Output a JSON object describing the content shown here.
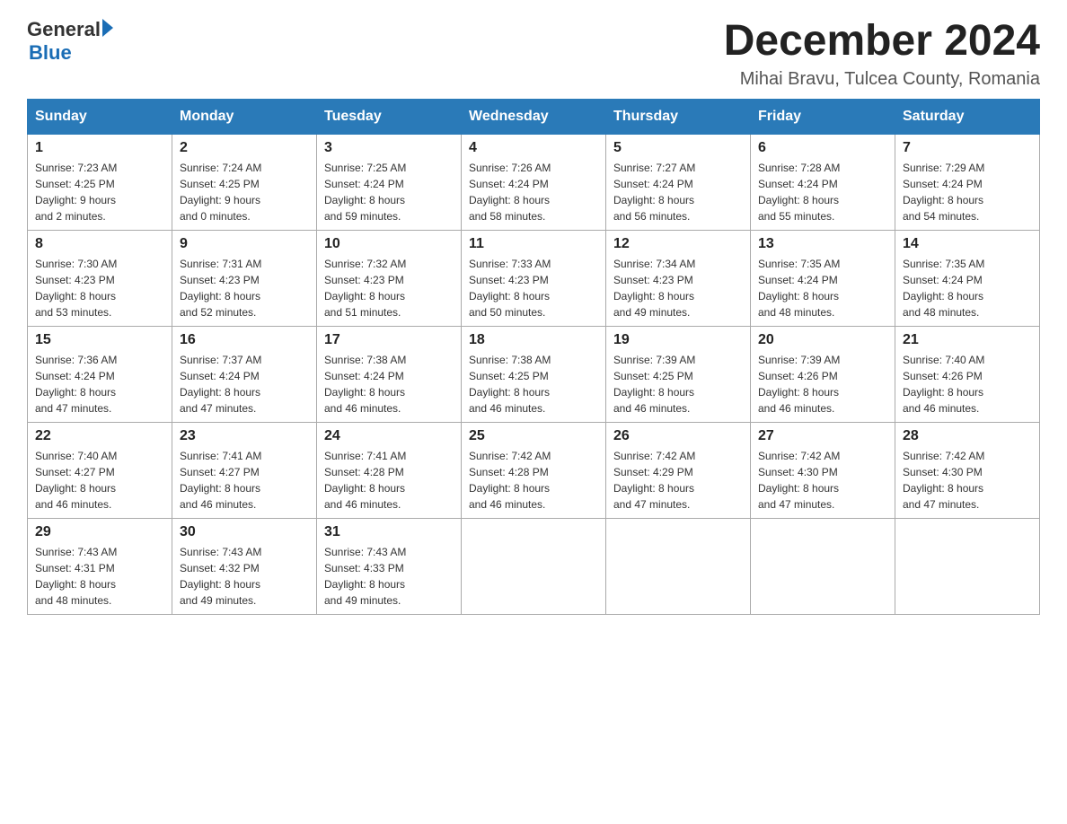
{
  "header": {
    "logo_general": "General",
    "logo_blue": "Blue",
    "month_title": "December 2024",
    "location": "Mihai Bravu, Tulcea County, Romania"
  },
  "days_of_week": [
    "Sunday",
    "Monday",
    "Tuesday",
    "Wednesday",
    "Thursday",
    "Friday",
    "Saturday"
  ],
  "weeks": [
    [
      {
        "day": "1",
        "sunrise": "7:23 AM",
        "sunset": "4:25 PM",
        "daylight": "9 hours and 2 minutes."
      },
      {
        "day": "2",
        "sunrise": "7:24 AM",
        "sunset": "4:25 PM",
        "daylight": "9 hours and 0 minutes."
      },
      {
        "day": "3",
        "sunrise": "7:25 AM",
        "sunset": "4:24 PM",
        "daylight": "8 hours and 59 minutes."
      },
      {
        "day": "4",
        "sunrise": "7:26 AM",
        "sunset": "4:24 PM",
        "daylight": "8 hours and 58 minutes."
      },
      {
        "day": "5",
        "sunrise": "7:27 AM",
        "sunset": "4:24 PM",
        "daylight": "8 hours and 56 minutes."
      },
      {
        "day": "6",
        "sunrise": "7:28 AM",
        "sunset": "4:24 PM",
        "daylight": "8 hours and 55 minutes."
      },
      {
        "day": "7",
        "sunrise": "7:29 AM",
        "sunset": "4:24 PM",
        "daylight": "8 hours and 54 minutes."
      }
    ],
    [
      {
        "day": "8",
        "sunrise": "7:30 AM",
        "sunset": "4:23 PM",
        "daylight": "8 hours and 53 minutes."
      },
      {
        "day": "9",
        "sunrise": "7:31 AM",
        "sunset": "4:23 PM",
        "daylight": "8 hours and 52 minutes."
      },
      {
        "day": "10",
        "sunrise": "7:32 AM",
        "sunset": "4:23 PM",
        "daylight": "8 hours and 51 minutes."
      },
      {
        "day": "11",
        "sunrise": "7:33 AM",
        "sunset": "4:23 PM",
        "daylight": "8 hours and 50 minutes."
      },
      {
        "day": "12",
        "sunrise": "7:34 AM",
        "sunset": "4:23 PM",
        "daylight": "8 hours and 49 minutes."
      },
      {
        "day": "13",
        "sunrise": "7:35 AM",
        "sunset": "4:24 PM",
        "daylight": "8 hours and 48 minutes."
      },
      {
        "day": "14",
        "sunrise": "7:35 AM",
        "sunset": "4:24 PM",
        "daylight": "8 hours and 48 minutes."
      }
    ],
    [
      {
        "day": "15",
        "sunrise": "7:36 AM",
        "sunset": "4:24 PM",
        "daylight": "8 hours and 47 minutes."
      },
      {
        "day": "16",
        "sunrise": "7:37 AM",
        "sunset": "4:24 PM",
        "daylight": "8 hours and 47 minutes."
      },
      {
        "day": "17",
        "sunrise": "7:38 AM",
        "sunset": "4:24 PM",
        "daylight": "8 hours and 46 minutes."
      },
      {
        "day": "18",
        "sunrise": "7:38 AM",
        "sunset": "4:25 PM",
        "daylight": "8 hours and 46 minutes."
      },
      {
        "day": "19",
        "sunrise": "7:39 AM",
        "sunset": "4:25 PM",
        "daylight": "8 hours and 46 minutes."
      },
      {
        "day": "20",
        "sunrise": "7:39 AM",
        "sunset": "4:26 PM",
        "daylight": "8 hours and 46 minutes."
      },
      {
        "day": "21",
        "sunrise": "7:40 AM",
        "sunset": "4:26 PM",
        "daylight": "8 hours and 46 minutes."
      }
    ],
    [
      {
        "day": "22",
        "sunrise": "7:40 AM",
        "sunset": "4:27 PM",
        "daylight": "8 hours and 46 minutes."
      },
      {
        "day": "23",
        "sunrise": "7:41 AM",
        "sunset": "4:27 PM",
        "daylight": "8 hours and 46 minutes."
      },
      {
        "day": "24",
        "sunrise": "7:41 AM",
        "sunset": "4:28 PM",
        "daylight": "8 hours and 46 minutes."
      },
      {
        "day": "25",
        "sunrise": "7:42 AM",
        "sunset": "4:28 PM",
        "daylight": "8 hours and 46 minutes."
      },
      {
        "day": "26",
        "sunrise": "7:42 AM",
        "sunset": "4:29 PM",
        "daylight": "8 hours and 47 minutes."
      },
      {
        "day": "27",
        "sunrise": "7:42 AM",
        "sunset": "4:30 PM",
        "daylight": "8 hours and 47 minutes."
      },
      {
        "day": "28",
        "sunrise": "7:42 AM",
        "sunset": "4:30 PM",
        "daylight": "8 hours and 47 minutes."
      }
    ],
    [
      {
        "day": "29",
        "sunrise": "7:43 AM",
        "sunset": "4:31 PM",
        "daylight": "8 hours and 48 minutes."
      },
      {
        "day": "30",
        "sunrise": "7:43 AM",
        "sunset": "4:32 PM",
        "daylight": "8 hours and 49 minutes."
      },
      {
        "day": "31",
        "sunrise": "7:43 AM",
        "sunset": "4:33 PM",
        "daylight": "8 hours and 49 minutes."
      },
      null,
      null,
      null,
      null
    ]
  ]
}
